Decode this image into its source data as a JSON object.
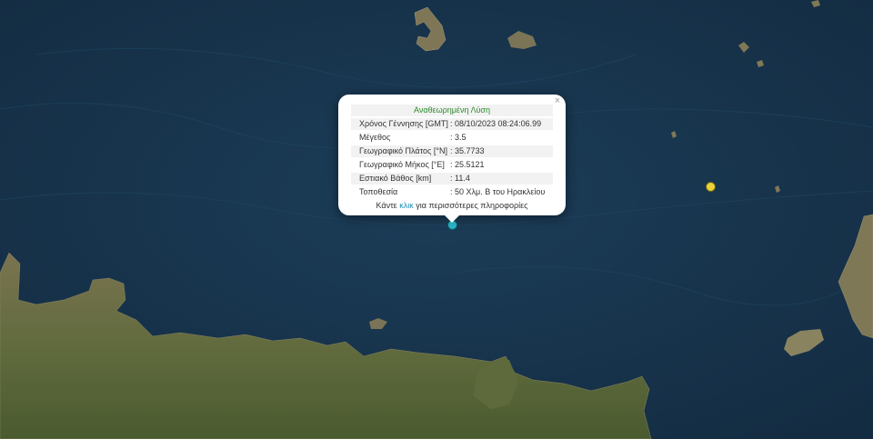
{
  "popup": {
    "title": "Αναθεωρημένη Λύση",
    "close_label": "×",
    "rows": [
      {
        "label": "Χρόνος Γέννησης [GMT]",
        "value": ": 08/10/2023 08:24:06.99"
      },
      {
        "label": "Μέγεθος",
        "value": ": 3.5"
      },
      {
        "label": "Γεωγραφικό Πλάτος [°N]",
        "value": ": 35.7733"
      },
      {
        "label": "Γεωγραφικό Μήκος [°E]",
        "value": ": 25.5121"
      },
      {
        "label": "Εστιακό Βάθος [km]",
        "value": ": 11.4"
      },
      {
        "label": "Τοποθεσία",
        "value": ": 50 Χλμ. Β του Ηρακλείου"
      }
    ],
    "footer": {
      "prefix": "Κάντε",
      "link": "κλικ",
      "suffix": "για περισσότερες πληροφορίες"
    }
  },
  "colors": {
    "sea": "#17344d",
    "land": "#6d6a45",
    "title_green": "#2e8b2e",
    "link_blue": "#1b8fb5",
    "selected_event": "#2bb7c9",
    "other_event": "#e8d33a"
  }
}
